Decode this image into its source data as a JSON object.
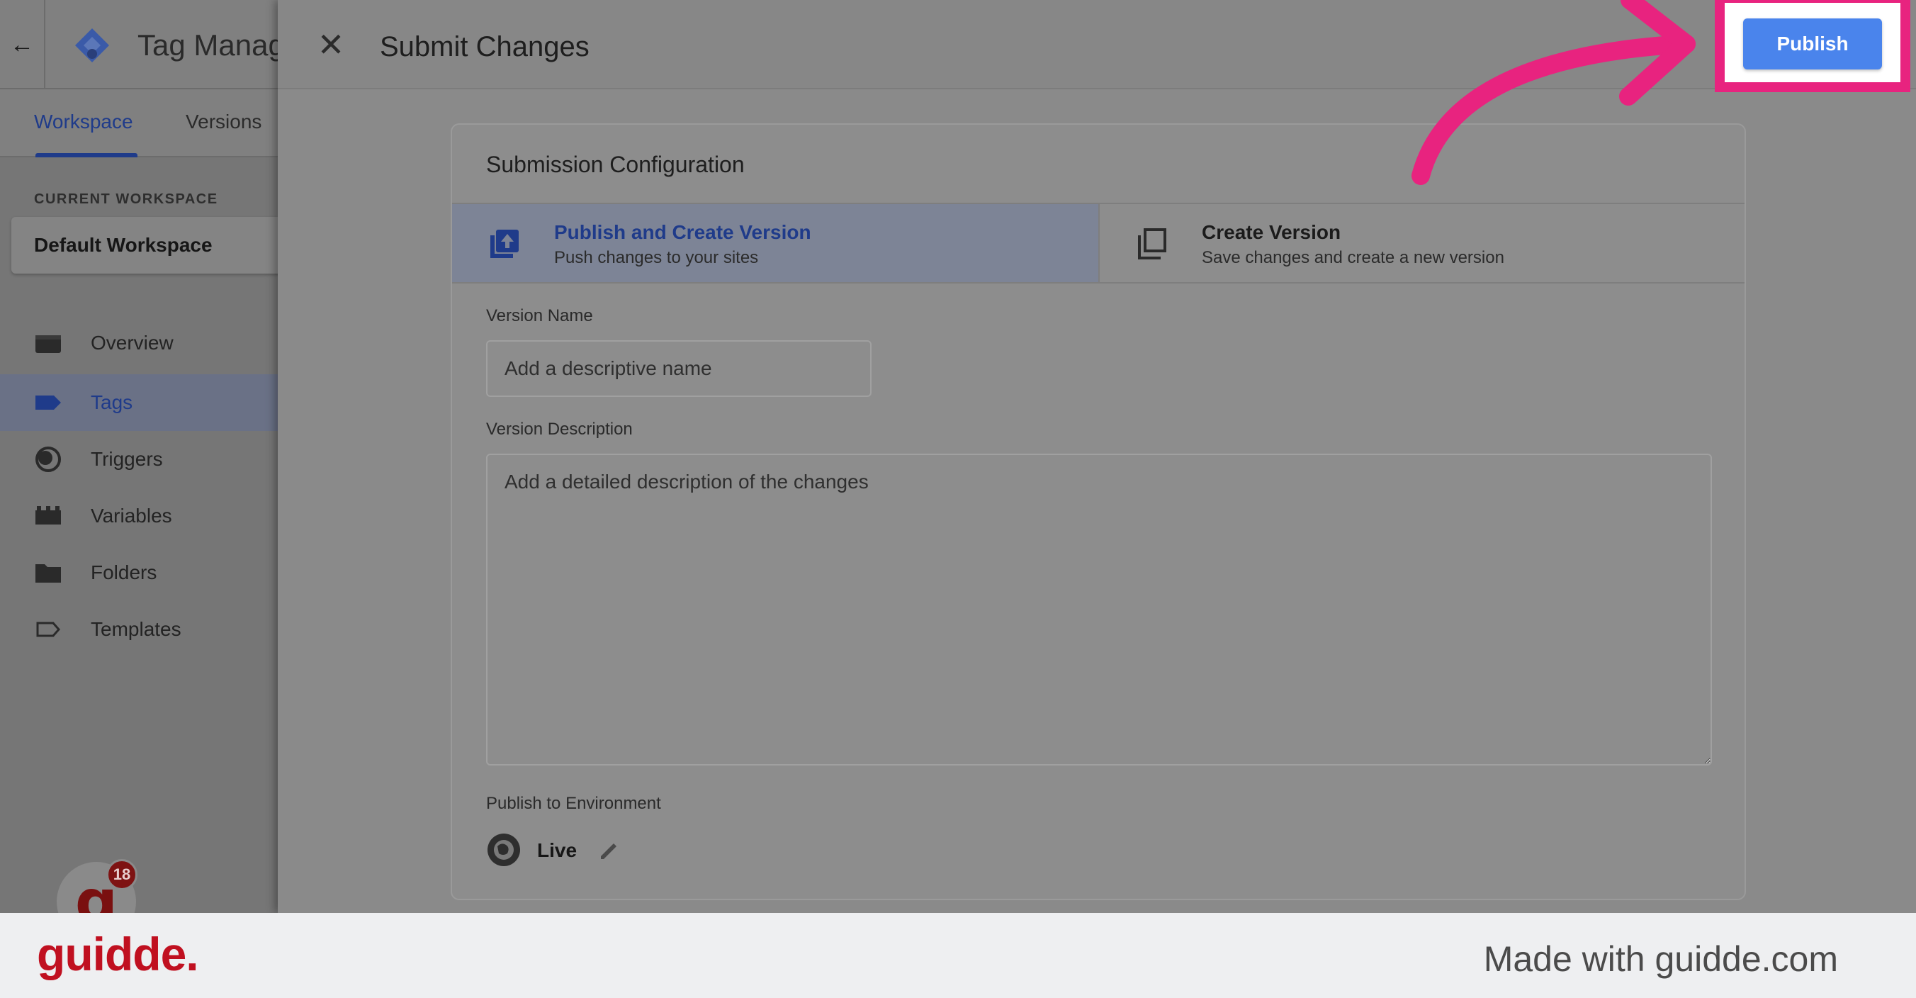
{
  "app": {
    "title": "Tag Manag",
    "tabs": [
      {
        "label": "Workspace",
        "active": true
      },
      {
        "label": "Versions",
        "active": false
      }
    ],
    "current_workspace_label": "CURRENT WORKSPACE",
    "workspace_name": "Default Workspace",
    "nav": [
      {
        "label": "Overview",
        "icon": "briefcase-icon",
        "active": false
      },
      {
        "label": "Tags",
        "icon": "tag-icon",
        "active": true
      },
      {
        "label": "Triggers",
        "icon": "trigger-icon",
        "active": false
      },
      {
        "label": "Variables",
        "icon": "variables-icon",
        "active": false
      },
      {
        "label": "Folders",
        "icon": "folder-icon",
        "active": false
      },
      {
        "label": "Templates",
        "icon": "template-icon",
        "active": false
      }
    ],
    "notification_count": "18",
    "accent_color": "#1f3b8a"
  },
  "panel": {
    "title": "Submit Changes",
    "card_title": "Submission Configuration",
    "options": [
      {
        "title": "Publish and Create Version",
        "subtitle": "Push changes to your sites",
        "selected": true,
        "icon": "publish-upload-icon"
      },
      {
        "title": "Create Version",
        "subtitle": "Save changes and create a new version",
        "selected": false,
        "icon": "copy-version-icon"
      }
    ],
    "version_name": {
      "label": "Version Name",
      "placeholder": "Add a descriptive name",
      "value": ""
    },
    "version_description": {
      "label": "Version Description",
      "placeholder": "Add a detailed description of the changes",
      "value": ""
    },
    "environment": {
      "label": "Publish to Environment",
      "name": "Live",
      "icon": "globe-icon"
    }
  },
  "publish_button": {
    "label": "Publish",
    "color": "#4a84ec",
    "highlight_color": "#e8237f"
  },
  "footer": {
    "logo": "guidde.",
    "made_with": "Made with guidde.com",
    "logo_color": "#c01020"
  }
}
